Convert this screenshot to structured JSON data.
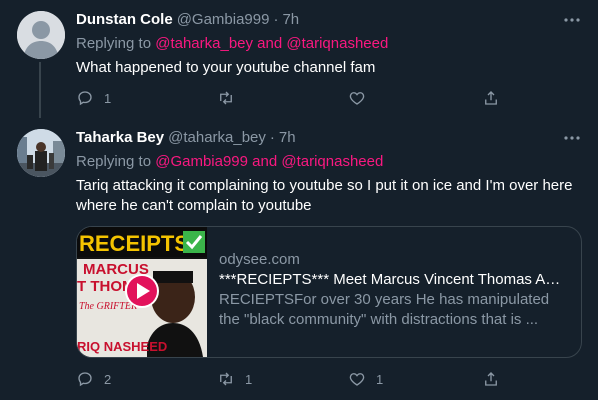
{
  "tweets": [
    {
      "name": "Dunstan Cole",
      "handle": "@Gambia999",
      "dot": "·",
      "time": "7h",
      "replying_prefix": "Replying to ",
      "replying_mentions": "@taharka_bey and @tariqnasheed",
      "text": "What happened to your youtube channel fam",
      "reply_count": "1",
      "retweet_count": "",
      "like_count": ""
    },
    {
      "name": "Taharka Bey",
      "handle": "@taharka_bey",
      "dot": "·",
      "time": "7h",
      "replying_prefix": "Replying to ",
      "replying_mentions": "@Gambia999 and @tariqnasheed",
      "text": "Tariq  attacking it complaining to youtube so I put it on ice and I'm over here where he can't complain to youtube",
      "reply_count": "2",
      "retweet_count": "1",
      "like_count": "1",
      "card": {
        "domain": "odysee.com",
        "title": "***RECIEPTS*** Meet Marcus Vincent Thomas AKA ...",
        "description": "RECIEPTSFor over 30 years He has manipulated the \"black community\" with distractions that is ...",
        "thumb_text_top": "RECEIPTS",
        "thumb_text_mid1": "MARCUS",
        "thumb_text_mid2": "T THOMA",
        "thumb_text_grifter": "The GRIFTER",
        "thumb_text_bottom": "RIQ NASHEED"
      }
    }
  ],
  "colors": {
    "background": "#15202b",
    "secondary_text": "#8b98a5",
    "mention": "#f91880",
    "border": "#38444d"
  },
  "icons": [
    "more-icon",
    "reply-icon",
    "retweet-icon",
    "like-icon",
    "share-icon",
    "play-icon",
    "checkmark-icon"
  ]
}
